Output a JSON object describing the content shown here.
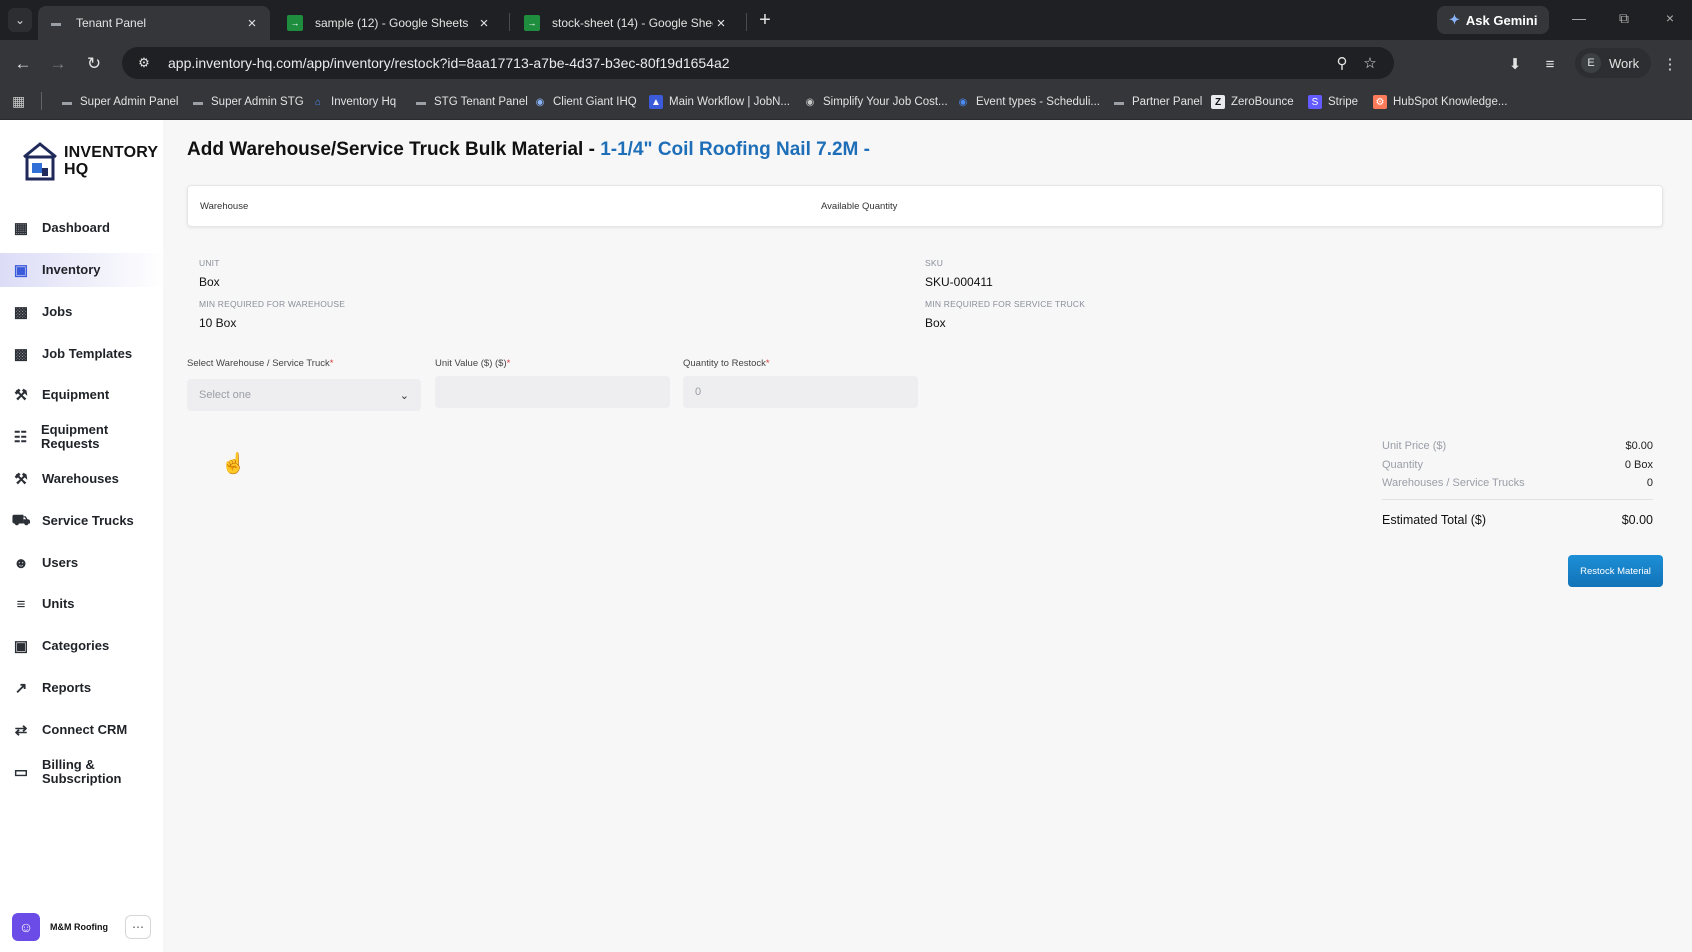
{
  "browser": {
    "tabs": [
      {
        "title": "Tenant Panel",
        "active": true
      },
      {
        "title": "sample (12) - Google Sheets",
        "active": false
      },
      {
        "title": "stock-sheet (14) - Google Sheets",
        "active": false
      }
    ],
    "new_tab_symbol": "+",
    "gemini_label": "Ask Gemini",
    "url": "app.inventory-hq.com/app/inventory/restock?id=8aa17713-a7be-4d37-b3ec-80f19d1654a2",
    "profile_initial": "E",
    "profile_label": "Work",
    "bookmarks": [
      {
        "label": "Super Admin Panel"
      },
      {
        "label": "Super Admin STG"
      },
      {
        "label": "Inventory Hq"
      },
      {
        "label": "STG Tenant Panel"
      },
      {
        "label": "Client Giant IHQ"
      },
      {
        "label": "Main Workflow | JobN..."
      },
      {
        "label": "Simplify Your Job Cost..."
      },
      {
        "label": "Event types - Scheduli..."
      },
      {
        "label": "Partner Panel"
      },
      {
        "label": "ZeroBounce"
      },
      {
        "label": "Stripe"
      },
      {
        "label": "HubSpot Knowledge..."
      }
    ]
  },
  "logo": {
    "line1": "INVENTORY",
    "line2": "HQ"
  },
  "sidebar": {
    "items": [
      {
        "label": "Dashboard",
        "icon": "dashboard-icon"
      },
      {
        "label": "Inventory",
        "icon": "inventory-icon",
        "active": true
      },
      {
        "label": "Jobs",
        "icon": "jobs-icon"
      },
      {
        "label": "Job Templates",
        "icon": "job-templates-icon"
      },
      {
        "label": "Equipment",
        "icon": "equipment-icon"
      },
      {
        "label": "Equipment Requests",
        "icon": "equipment-requests-icon"
      },
      {
        "label": "Warehouses",
        "icon": "warehouses-icon"
      },
      {
        "label": "Service Trucks",
        "icon": "truck-icon"
      },
      {
        "label": "Users",
        "icon": "users-icon"
      },
      {
        "label": "Units",
        "icon": "units-icon"
      },
      {
        "label": "Categories",
        "icon": "categories-icon"
      },
      {
        "label": "Reports",
        "icon": "reports-icon"
      },
      {
        "label": "Connect CRM",
        "icon": "crm-icon"
      },
      {
        "label": "Billing & Subscription",
        "icon": "billing-icon"
      }
    ],
    "user": {
      "name": "M&M Roofing",
      "more": "⋯"
    }
  },
  "page": {
    "title_prefix": "Add Warehouse/Service Truck Bulk Material - ",
    "title_item": "1-1/4\" Coil Roofing Nail 7.2M -",
    "table_headers": {
      "warehouse": "Warehouse",
      "available_quantity": "Available Quantity"
    },
    "info": {
      "unit_label": "UNIT",
      "unit_value": "Box",
      "sku_label": "SKU",
      "sku_value": "SKU-000411",
      "min_wh_label": "MIN REQUIRED FOR WAREHOUSE",
      "min_wh_value": "10 Box",
      "min_truck_label": "MIN REQUIRED FOR SERVICE TRUCK",
      "min_truck_value": "Box"
    },
    "form": {
      "select_label": "Select Warehouse / Service Truck",
      "select_placeholder": "Select one",
      "unit_value_label": "Unit Value ($) ($)",
      "unit_value_value": "",
      "qty_label": "Quantity to Restock",
      "qty_placeholder": "0",
      "required_mark": "*"
    },
    "summary": {
      "unit_price_label": "Unit Price ($)",
      "unit_price_value": "$0.00",
      "quantity_label": "Quantity",
      "quantity_value": "0 Box",
      "wh_label": "Warehouses / Service Trucks",
      "wh_value": "0",
      "total_label": "Estimated Total ($)",
      "total_value": "$0.00"
    },
    "restock_button": "Restock Material"
  },
  "colors": {
    "accent_blue": "#1f6fb8",
    "button_blue": "#1a86cc",
    "active_nav_bg": "#dcdcf7",
    "required_red": "#d63939"
  }
}
